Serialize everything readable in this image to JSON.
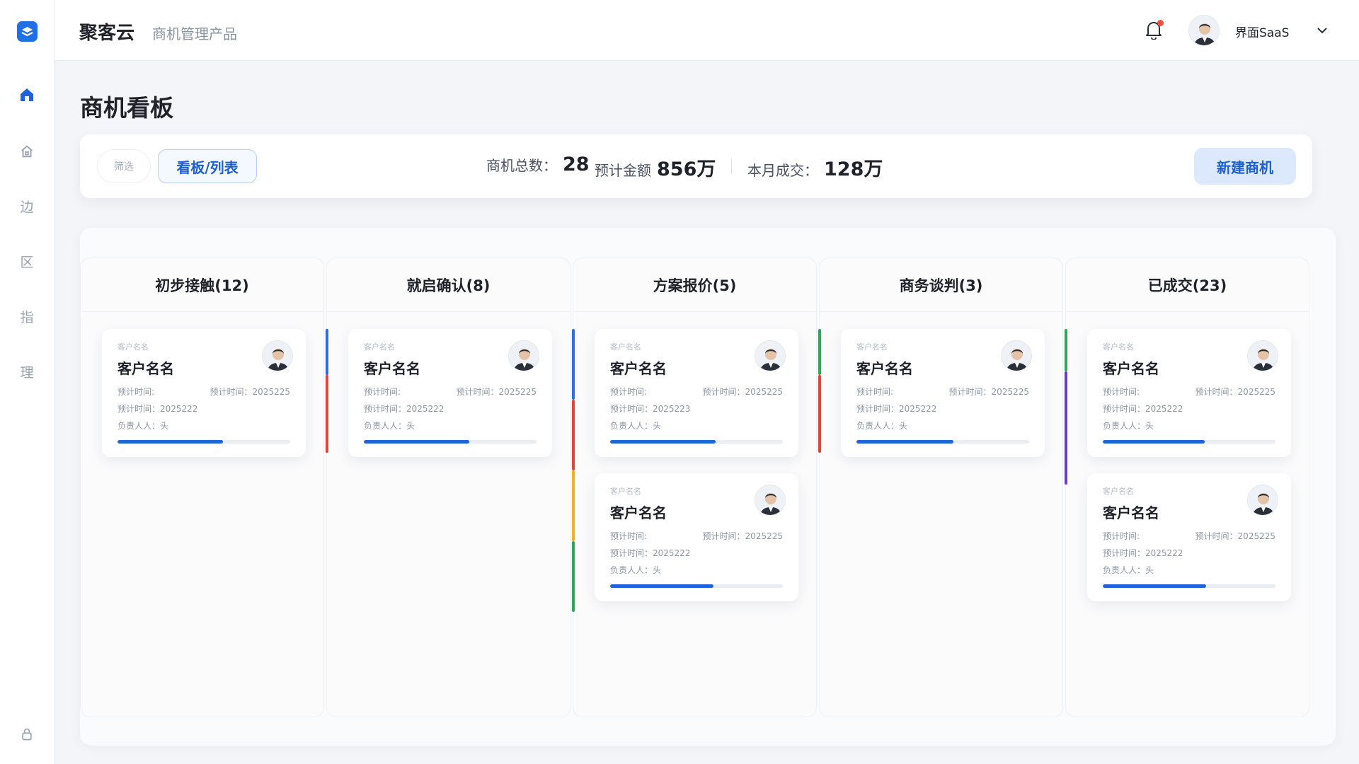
{
  "app": {
    "brand": "聚客云",
    "subtitle": "商机管理产品",
    "user_name": "界面SaaS",
    "colors": {
      "accent": "#1f63d8",
      "notification": "#f0513a"
    }
  },
  "sidebar": {
    "items": [
      {
        "icon": "home-icon",
        "glyph": "⌂"
      },
      {
        "icon": "house-outline-icon",
        "glyph": "⌂"
      },
      {
        "icon": "nav-edge-icon",
        "glyph": "边"
      },
      {
        "icon": "nav-zone-icon",
        "glyph": "区"
      },
      {
        "icon": "nav-guide-icon",
        "glyph": "指"
      },
      {
        "icon": "nav-manage-icon",
        "glyph": "理"
      },
      {
        "icon": "lock-icon",
        "glyph": "⌂"
      }
    ]
  },
  "page": {
    "title": "商机看板"
  },
  "toolbar": {
    "filter_label": "筛选",
    "view_toggle_label": "看板/列表",
    "new_button_label": "新建商机"
  },
  "stats": {
    "total_label": "商机总数：",
    "total_value": "28",
    "amount_label": "预计金额",
    "amount_value": "856万",
    "monthly_label": "本月成交：",
    "monthly_value": "128万"
  },
  "columns": [
    {
      "title": "初步接触(12)",
      "rail_colors": [
        "#2f6ee0",
        "#e0443b"
      ],
      "cards": [
        {
          "tag": "客户名名",
          "name": "客户名名",
          "time_label": "预计时间:",
          "time_right": "预计时间：2025225",
          "date_line": "预计时间：2025222",
          "owner_line": "负责人人：头",
          "progress": 0.61
        }
      ]
    },
    {
      "title": "就启确认(8)",
      "rail_colors": [
        "#2f6ee0",
        "#e0443b"
      ],
      "cards": [
        {
          "tag": "客户名名",
          "name": "客户名名",
          "time_label": "预计时间:",
          "time_right": "预计时间：2025225",
          "date_line": "预计时间：2025222",
          "owner_line": "负责人人：头",
          "progress": 0.61
        }
      ]
    },
    {
      "title": "方案报价(5)",
      "rail_colors": [
        "#2f6ee0",
        "#e0443b",
        "#f2b21c",
        "#2fa65a"
      ],
      "cards": [
        {
          "tag": "客户名名",
          "name": "客户名名",
          "time_label": "预计时间:",
          "time_right": "预计时间：2025225",
          "date_line": "预计时间：2025223",
          "owner_line": "负责人人：头",
          "progress": 0.61
        },
        {
          "tag": "客户名名",
          "name": "客户名名",
          "time_label": "预计时间:",
          "time_right": "预计时间：2025225",
          "date_line": "预计时间：2025222",
          "owner_line": "负责人人：头",
          "progress": 0.6
        }
      ]
    },
    {
      "title": "商务谈判(3)",
      "rail_colors": [
        "#2fa65a",
        "#e0443b"
      ],
      "cards": [
        {
          "tag": "客户名名",
          "name": "客户名名",
          "time_label": "预计时间:",
          "time_right": "预计时间：2025225",
          "date_line": "预计时间：2025222",
          "owner_line": "负责人人：头",
          "progress": 0.56
        }
      ]
    },
    {
      "title": "已成交(23)",
      "rail_colors": [
        "#2fa65a",
        "#6a3fc4"
      ],
      "cards": [
        {
          "tag": "客户名名",
          "name": "客户名名",
          "time_label": "预计时间:",
          "time_right": "预计时间：2025225",
          "date_line": "预计时间：2025222",
          "owner_line": "负责人人：头",
          "progress": 0.59
        },
        {
          "tag": "客户名名",
          "name": "客户名名",
          "time_label": "预计时间:",
          "time_right": "预计时间：2025225",
          "date_line": "预计时间：2025222",
          "owner_line": "负责人人：头",
          "progress": 0.6
        }
      ]
    }
  ]
}
